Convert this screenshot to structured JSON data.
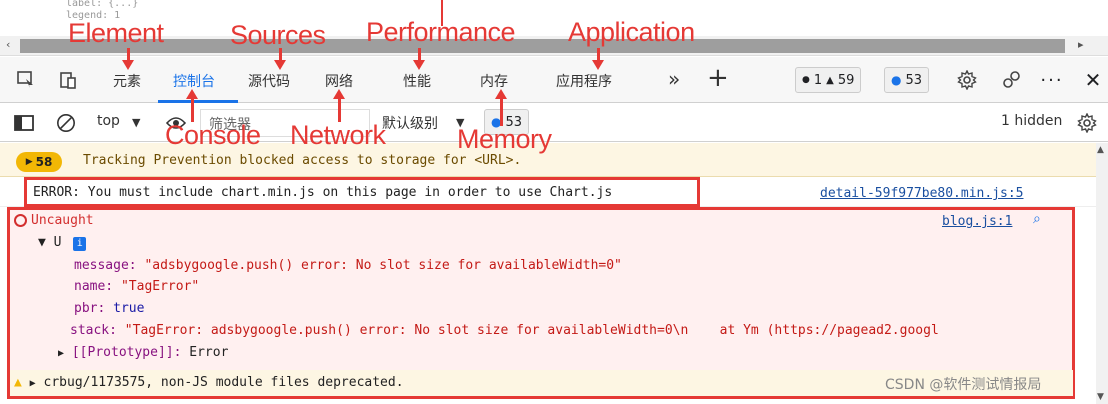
{
  "code_top": {
    "line1": "label: {...}",
    "line2": "legend: 1"
  },
  "tabs": [
    {
      "label": "元素"
    },
    {
      "label": "控制台"
    },
    {
      "label": "源代码"
    },
    {
      "label": "网络"
    },
    {
      "label": "性能"
    },
    {
      "label": "内存"
    },
    {
      "label": "应用程序"
    }
  ],
  "toolbar": {
    "more_tabs": "»",
    "add_tab": "+",
    "errors_count": "1",
    "warnings_count": "59",
    "issues_count": "53",
    "close": "✕"
  },
  "filterbar": {
    "context": "top",
    "filter_placeholder": "筛选器",
    "levels": "默认级别",
    "issues_count": "53",
    "hidden": "1 hidden"
  },
  "annotations": {
    "element": "Element",
    "sources": "Sources",
    "performance": "Performance",
    "application": "Application",
    "console": "Console",
    "network": "Network",
    "memory": "Memory"
  },
  "messages": {
    "warn_count": "58",
    "warn_text": "Tracking Prevention blocked access to storage for <URL>.",
    "error_text": "ERROR: You must include chart.min.js on this page in order to use Chart.js",
    "error_source": "detail-59f977be80.min.js:5",
    "uncaught_label": "Uncaught",
    "uncaught_source": "blog.js:1",
    "obj_name": "U",
    "message_key": "message:",
    "message_val": "\"adsbygoogle.push() error: No slot size for availableWidth=0\"",
    "name_key": "name:",
    "name_val": "\"TagError\"",
    "pbr_key": "pbr:",
    "pbr_val": "true",
    "stack_key": "stack:",
    "stack_val": "\"TagError: adsbygoogle.push() error: No slot size for availableWidth=0\\n    at Ym (https://pagead2.googl",
    "proto_key": "[[Prototype]]:",
    "proto_val": "Error",
    "deprecated_text": "crbug/1173575, non-JS module files deprecated."
  },
  "watermark": "CSDN @软件测试情报局",
  "colors": {
    "accent": "#1a73e8",
    "annotation_red": "#e53935",
    "warning_bg": "#fdf6e3",
    "error_bg": "#fff0f0"
  }
}
